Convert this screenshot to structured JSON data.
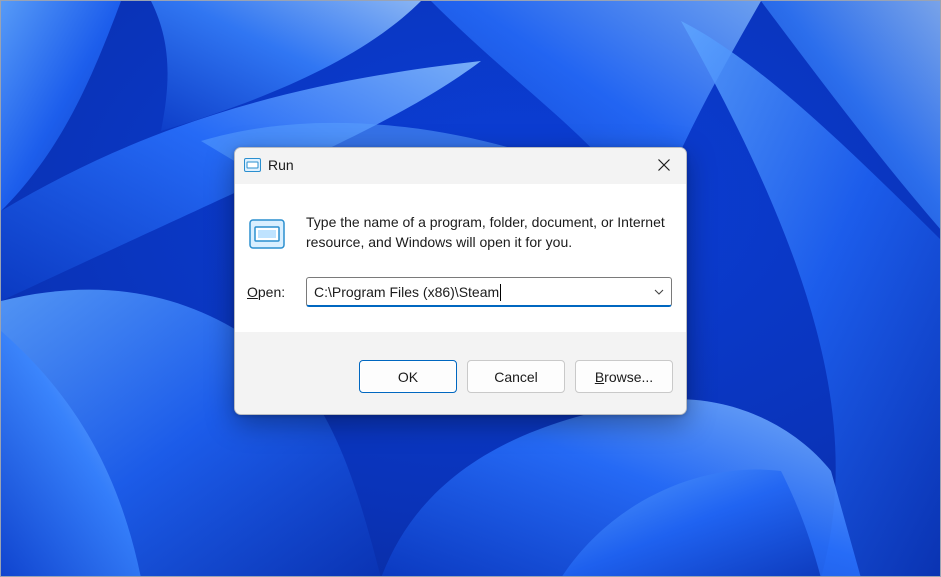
{
  "dialog": {
    "title": "Run",
    "description": "Type the name of a program, folder, document, or Internet resource, and Windows will open it for you.",
    "open_label_accesskey": "O",
    "open_label_rest": "pen:",
    "open_value": "C:\\Program Files (x86)\\Steam",
    "buttons": {
      "ok": "OK",
      "cancel": "Cancel",
      "browse_accesskey": "B",
      "browse_rest": "rowse..."
    }
  },
  "icons": {
    "title": "run-icon",
    "close": "close-icon",
    "dropdown": "chevron-down-icon",
    "main": "run-icon"
  },
  "colors": {
    "accent": "#0067c0",
    "wallpaper_dark": "#0a2fa8",
    "wallpaper_light": "#3d8bff",
    "dialog_bg": "#f3f3f3"
  }
}
